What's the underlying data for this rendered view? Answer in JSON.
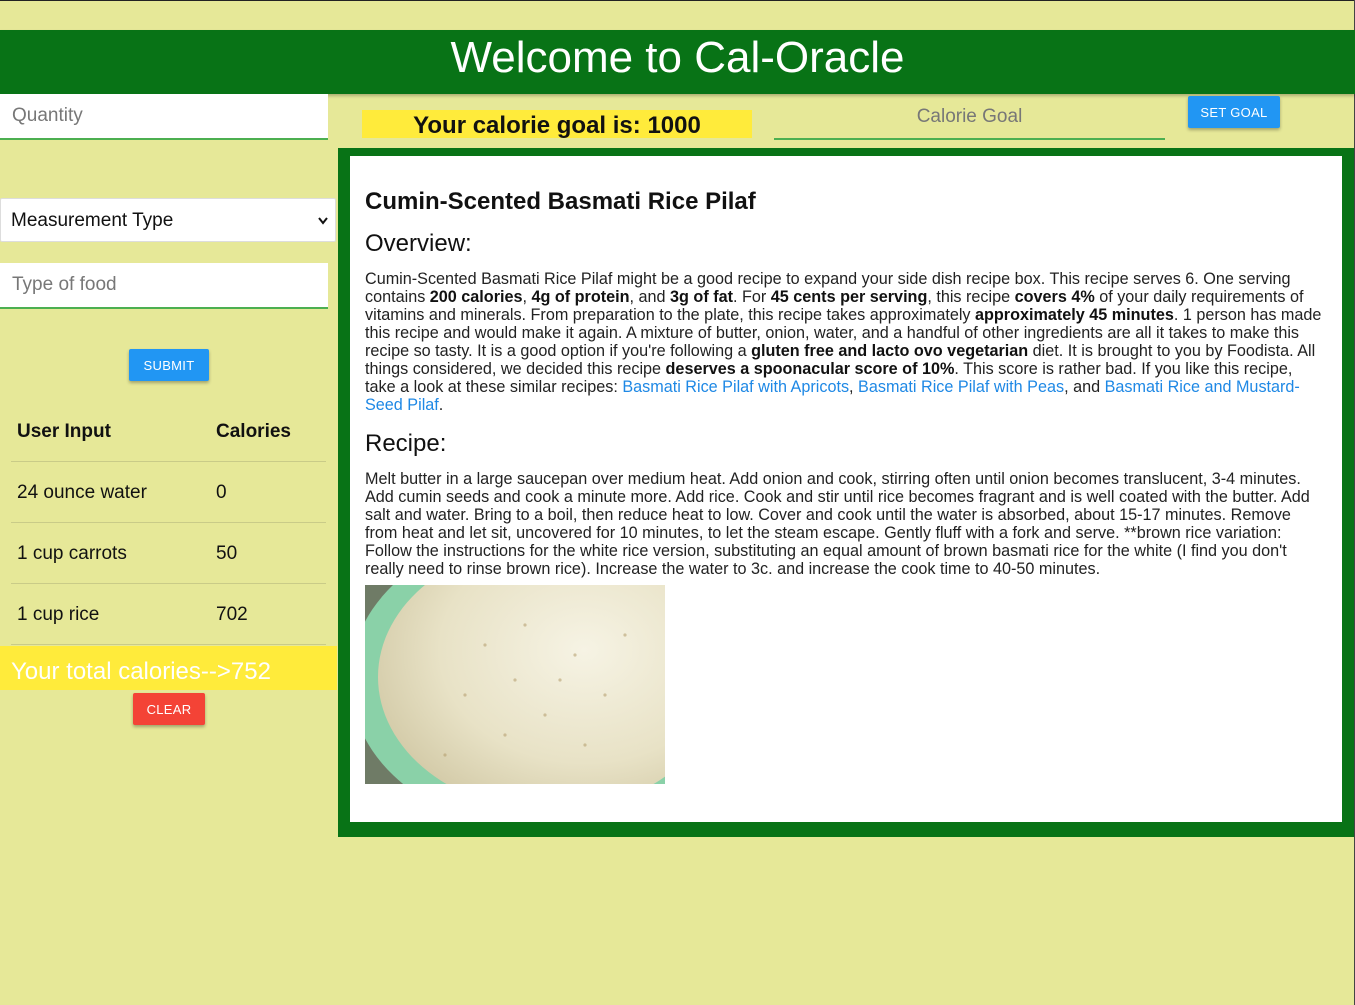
{
  "header": {
    "title": "Welcome to Cal-Oracle"
  },
  "form": {
    "quantity_placeholder": "Quantity",
    "measurement_selected": "Measurement Type",
    "food_placeholder": "Type of food",
    "submit_label": "SUBMIT"
  },
  "table": {
    "headers": [
      "User Input",
      "Calories"
    ],
    "rows": [
      {
        "input": "24 ounce water",
        "calories": "0"
      },
      {
        "input": "1 cup carrots",
        "calories": "50"
      },
      {
        "input": "1 cup rice",
        "calories": "702"
      }
    ]
  },
  "total": {
    "text": "Your total calories-->752"
  },
  "clear_label": "CLEAR",
  "goal": {
    "text": "Your calorie goal is: 1000",
    "input_placeholder": "Calorie Goal",
    "set_label": "SET GOAL"
  },
  "recipe": {
    "title": "Cumin-Scented Basmati Rice Pilaf",
    "overview_heading": "Overview:",
    "overview": [
      {
        "t": "Cumin-Scented Basmati Rice Pilaf might be a good recipe to expand your side dish recipe box. This recipe serves 6. One serving contains "
      },
      {
        "b": "200 calories"
      },
      {
        "t": ", "
      },
      {
        "b": "4g of protein"
      },
      {
        "t": ", and "
      },
      {
        "b": "3g of fat"
      },
      {
        "t": ". For "
      },
      {
        "b": "45 cents per serving"
      },
      {
        "t": ", this recipe "
      },
      {
        "b": "covers 4%"
      },
      {
        "t": " of your daily requirements of vitamins and minerals. From preparation to the plate, this recipe takes approximately "
      },
      {
        "b": "approximately 45 minutes"
      },
      {
        "t": ". 1 person has made this recipe and would make it again. A mixture of butter, onion, water, and a handful of other ingredients are all it takes to make this recipe so tasty. It is a good option if you're following a "
      },
      {
        "b": "gluten free and lacto ovo vegetarian"
      },
      {
        "t": " diet. It is brought to you by Foodista. All things considered, we decided this recipe "
      },
      {
        "b": "deserves a spoonacular score of 10%"
      },
      {
        "t": ". This score is rather bad. If you like this recipe, take a look at these similar recipes: "
      },
      {
        "a": "Basmati Rice Pilaf with Apricots"
      },
      {
        "t": ", "
      },
      {
        "a": "Basmati Rice Pilaf with Peas"
      },
      {
        "t": ", and "
      },
      {
        "a": "Basmati Rice and Mustard-Seed Pilaf"
      },
      {
        "t": "."
      }
    ],
    "recipe_heading": "Recipe:",
    "instructions": "Melt butter in a large saucepan over medium heat. Add onion and cook, stirring often until onion becomes translucent, 3-4 minutes. Add cumin seeds and cook a minute more. Add rice. Cook and stir until rice becomes fragrant and is well coated with the butter. Add salt and water. Bring to a boil, then reduce heat to low. Cover and cook until the water is absorbed, about 15-17 minutes. Remove from heat and let sit, uncovered for 10 minutes, to let the steam escape. Gently fluff with a fork and serve. **brown rice variation: Follow the instructions for the white rice version, substituting an equal amount of brown basmati rice for the white (I find you don't really need to rinse brown rice). Increase the water to 3c. and increase the cook time to 40-50 minutes."
  },
  "colors": {
    "background": "#e6e898",
    "header_green": "#087316",
    "highlight_yellow": "#ffeb3b",
    "button_blue": "#2196f3",
    "button_red": "#f44336",
    "link_blue": "#1e88e5"
  }
}
